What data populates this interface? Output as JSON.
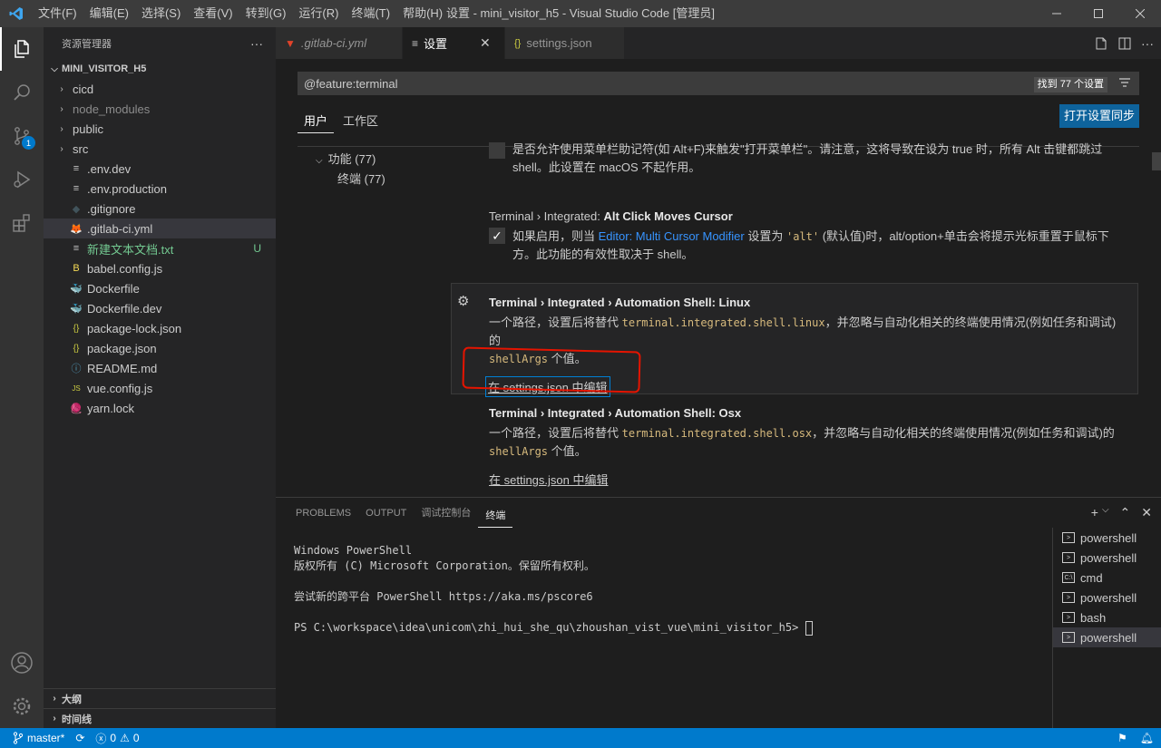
{
  "colors": {
    "accent": "#007acc",
    "statusbar": "#007acc",
    "sync_button": "#0e639c",
    "highlight_box": "#e51400",
    "link": "#3794ff"
  },
  "titlebar": {
    "menu": [
      "文件(F)",
      "编辑(E)",
      "选择(S)",
      "查看(V)",
      "转到(G)",
      "运行(R)",
      "终端(T)",
      "帮助(H)"
    ],
    "title": "设置 - mini_visitor_h5 - Visual Studio Code [管理员]"
  },
  "activity": {
    "scm_badge": "1",
    "icons": [
      "explorer-icon",
      "search-icon",
      "source-control-icon",
      "run-debug-icon",
      "extensions-icon",
      "account-icon",
      "manage-gear-icon"
    ]
  },
  "sidebar": {
    "header": "资源管理器",
    "more": "···",
    "root": "MINI_VISITOR_H5",
    "items": [
      {
        "label": "cicd",
        "type": "folder"
      },
      {
        "label": "node_modules",
        "type": "folder"
      },
      {
        "label": "public",
        "type": "folder"
      },
      {
        "label": "src",
        "type": "folder"
      },
      {
        "label": ".env.dev",
        "icon": "≡"
      },
      {
        "label": ".env.production",
        "icon": "≡"
      },
      {
        "label": ".gitignore",
        "icon": "◆"
      },
      {
        "label": ".gitlab-ci.yml",
        "icon": "🦊"
      },
      {
        "label": "新建文本文档.txt",
        "icon": "≡",
        "decoration": "U"
      },
      {
        "label": "babel.config.js",
        "icon": "B"
      },
      {
        "label": "Dockerfile",
        "icon": "🐳"
      },
      {
        "label": "Dockerfile.dev",
        "icon": "🐳"
      },
      {
        "label": "package-lock.json",
        "icon": "{}"
      },
      {
        "label": "package.json",
        "icon": "{}"
      },
      {
        "label": "README.md",
        "icon": "ⓘ"
      },
      {
        "label": "vue.config.js",
        "icon": "JS"
      },
      {
        "label": "yarn.lock",
        "icon": "🧶"
      }
    ],
    "outline": "大纲",
    "timeline": "时间线"
  },
  "tabs": [
    {
      "label": ".gitlab-ci.yml",
      "icon": "🦊"
    },
    {
      "label": "设置",
      "icon": "≡",
      "close": "✕"
    },
    {
      "label": "settings.json",
      "icon": "{}"
    }
  ],
  "settings": {
    "search_value": "@feature:terminal",
    "result_count": "找到 77 个设置",
    "scope_user": "用户",
    "scope_workspace": "工作区",
    "sync_button": "打开设置同步",
    "toc_feature": "功能 (77)",
    "toc_terminal": "终端 (77)",
    "partial_desc_1": "是否允许使用菜单栏助记符(如 Alt+F)来触发\"打开菜单栏\"。请注意，这将导致在设为 true 时，所有 Alt 击键都跳过",
    "partial_desc_2": "shell。此设置在 macOS 不起作用。",
    "alt_click": {
      "category": "Terminal › Integrated: ",
      "name": "Alt Click Moves Cursor",
      "desc_a": "如果启用，则当 ",
      "link": "Editor: Multi Cursor Modifier",
      "desc_b": " 设置为 ",
      "code": "'alt'",
      "desc_c": " (默认值)时，alt/option+单击会将提示光标重置于鼠标下",
      "desc_d": "方。此功能的有效性取决于 shell。",
      "checked": true
    },
    "linux": {
      "category": "Terminal › Integrated › Automation Shell: ",
      "name": "Linux",
      "desc_a": "一个路径，设置后将替代 ",
      "code": "terminal.integrated.shell.linux",
      "desc_b": "，并忽略与自动化相关的终端使用情况(例如任务和调试)的",
      "code2": "shellArgs",
      "desc_c": " 个值。",
      "edit_link": "在 settings.json 中编辑"
    },
    "osx": {
      "category": "Terminal › Integrated › Automation Shell: ",
      "name": "Osx",
      "desc_a": "一个路径，设置后将替代 ",
      "code": "terminal.integrated.shell.osx",
      "desc_b": "，并忽略与自动化相关的终端使用情况(例如任务和调试)的",
      "code2": "shellArgs",
      "desc_c": " 个值。",
      "edit_link": "在 settings.json 中编辑"
    }
  },
  "panel": {
    "tabs": [
      "PROBLEMS",
      "OUTPUT",
      "调试控制台",
      "终端"
    ],
    "terminal_lines": [
      "Windows PowerShell",
      "版权所有 (C) Microsoft Corporation。保留所有权利。",
      "",
      "尝试新的跨平台 PowerShell https://aka.ms/pscore6",
      "",
      "PS C:\\workspace\\idea\\unicom\\zhi_hui_she_qu\\zhoushan_vist_vue\\mini_visitor_h5> "
    ],
    "terminals": [
      "powershell",
      "powershell",
      "cmd",
      "powershell",
      "bash",
      "powershell"
    ]
  },
  "statusbar": {
    "branch": "master*",
    "errors": "0",
    "warnings": "0"
  }
}
